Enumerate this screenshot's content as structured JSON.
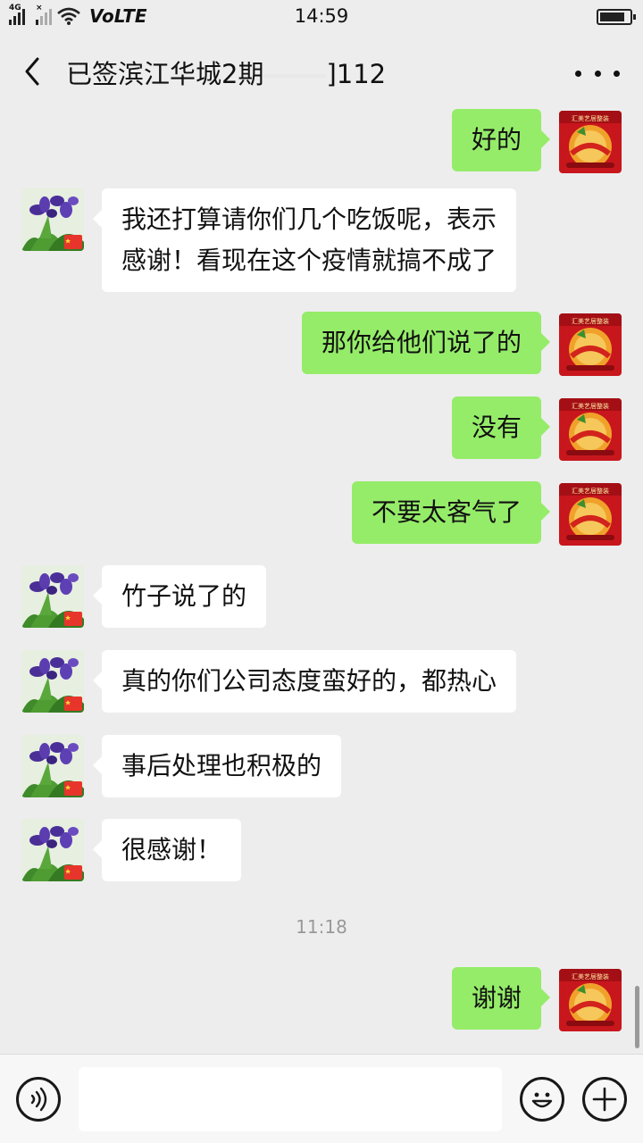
{
  "status_bar": {
    "network_tags": [
      "4G",
      "×"
    ],
    "volte": "VoLTE",
    "time": "14:59"
  },
  "header": {
    "title_prefix": "已签滨江华城2期",
    "title_suffix": "]112"
  },
  "avatar_caption": "汇美艺居整装",
  "messages": [
    {
      "direction": "out",
      "text": "好的"
    },
    {
      "direction": "in",
      "text": "我还打算请你们几个吃饭呢，表示\n感谢！看现在这个疫情就搞不成了"
    },
    {
      "direction": "out",
      "text": "那你给他们说了的"
    },
    {
      "direction": "out",
      "text": "没有"
    },
    {
      "direction": "out",
      "text": "不要太客气了"
    },
    {
      "direction": "in",
      "text": "竹子说了的"
    },
    {
      "direction": "in",
      "text": "真的你们公司态度蛮好的，都热心"
    },
    {
      "direction": "in",
      "text": "事后处理也积极的"
    },
    {
      "direction": "in",
      "text": "很感谢！"
    },
    {
      "direction": "out",
      "text": "谢谢"
    }
  ],
  "timestamp": "11:18",
  "input": {
    "value": "",
    "placeholder": ""
  },
  "icons": {
    "back": "chevron-left-icon",
    "more": "more-dots-icon",
    "voice": "voice-icon",
    "emoji": "emoji-icon",
    "plus": "plus-icon"
  },
  "colors": {
    "background": "#ededed",
    "outgoing_bubble": "#95ec69",
    "incoming_bubble": "#ffffff",
    "timestamp_text": "#999999"
  }
}
